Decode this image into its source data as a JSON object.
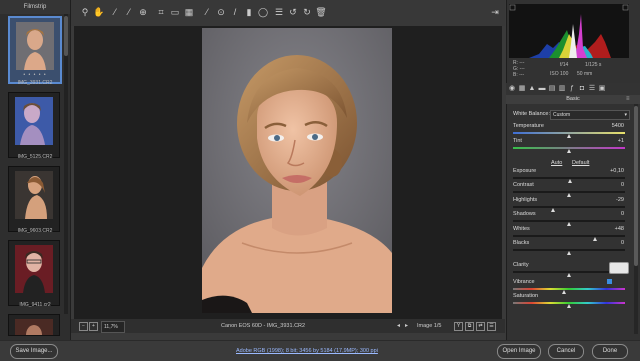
{
  "filmstrip": {
    "title": "Filmstrip",
    "items": [
      {
        "label": "IMG_3931.CR2",
        "stars": "• • • • •",
        "selected": true
      },
      {
        "label": "IMG_5125.CR2",
        "selected": false
      },
      {
        "label": "IMG_9603.CR2",
        "selected": false
      },
      {
        "label": "IMG_9411.cr2",
        "selected": false
      }
    ]
  },
  "toolbar": {
    "icons": [
      "zoom-icon",
      "hand-icon",
      "white-balance-icon",
      "color-sampler-icon",
      "targeted-adjust-icon",
      "crop-icon",
      "straighten-icon",
      "transform-icon",
      "spot-removal-icon",
      "red-eye-icon",
      "adjustment-brush-icon",
      "graduated-filter-icon",
      "radial-filter-icon",
      "preferences-icon",
      "rotate-left-icon",
      "rotate-right-icon",
      "trash-icon"
    ],
    "fullscreen_icon": "fullscreen-icon"
  },
  "canvas": {
    "zoom": "11,7%",
    "camera_file": "Canon EOS 60D  -  IMG_3931.CR2",
    "image_counter": "Image 1/5"
  },
  "bottom": {
    "save_label": "Save Image...",
    "workflow": "Adobe RGB (1998); 8 bit; 3456 by 5184 (17,9MP); 300 ppi",
    "open_label": "Open Image",
    "cancel_label": "Cancel",
    "done_label": "Done"
  },
  "info": {
    "r": "R:  ---",
    "g": "G:  ---",
    "b": "B:  ---",
    "aperture": "f/14",
    "shutter": "1/125 s",
    "iso": "ISO 100",
    "focal": "50 mm"
  },
  "basic": {
    "header": "Basic",
    "white_balance_label": "White Balance:",
    "white_balance_value": "Custom",
    "auto": "Auto",
    "default": "Default",
    "sliders": [
      {
        "label": "Temperature",
        "value": "5400",
        "pos": 0.5
      },
      {
        "label": "Tint",
        "value": "+1",
        "pos": 0.5
      },
      {
        "label": "Exposure",
        "value": "+0,10",
        "pos": 0.51
      },
      {
        "label": "Contrast",
        "value": "0",
        "pos": 0.5
      },
      {
        "label": "Highlights",
        "value": "-29",
        "pos": 0.36
      },
      {
        "label": "Shadows",
        "value": "0",
        "pos": 0.5
      },
      {
        "label": "Whites",
        "value": "+48",
        "pos": 0.74
      },
      {
        "label": "Blacks",
        "value": "0",
        "pos": 0.5
      },
      {
        "label": "Clarity",
        "value": "",
        "pos": 0.5
      },
      {
        "label": "Vibrance",
        "value": "",
        "pos": 0.46
      },
      {
        "label": "Saturation",
        "value": "",
        "pos": 0.5
      }
    ]
  },
  "colors": {
    "accent": "#5a8ad0",
    "photo_bg": "#6f6e73"
  }
}
